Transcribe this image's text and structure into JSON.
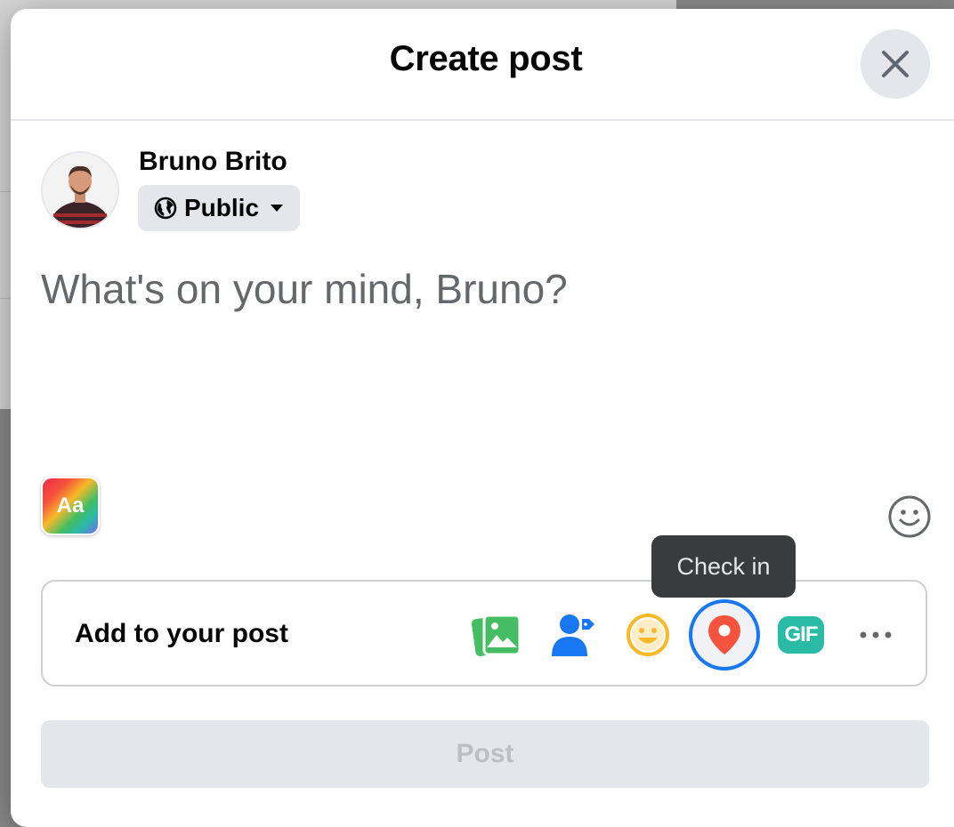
{
  "dialog": {
    "title": "Create post"
  },
  "author": {
    "name": "Bruno Brito",
    "audience_label": "Public"
  },
  "composer": {
    "placeholder": "What's on your mind, Bruno?"
  },
  "background_picker": {
    "label": "Aa"
  },
  "add_to_post": {
    "label": "Add to your post",
    "tools": [
      {
        "name": "photo-video",
        "icon": "photo-icon",
        "color": "#45bd62"
      },
      {
        "name": "tag-people",
        "icon": "tag-people-icon",
        "color": "#1877f2"
      },
      {
        "name": "feeling-activity",
        "icon": "smiley-icon",
        "color": "#f7b928"
      },
      {
        "name": "check-in",
        "icon": "location-pin-icon",
        "color": "#f5533d",
        "active": true
      },
      {
        "name": "gif",
        "icon": "gif-icon",
        "label": "GIF",
        "color": "#2abba7"
      },
      {
        "name": "more",
        "icon": "more-icon",
        "color": "#65676b"
      }
    ]
  },
  "tooltip": {
    "text": "Check in"
  },
  "post_button": {
    "label": "Post",
    "enabled": false
  },
  "colors": {
    "accent": "#1877f2",
    "button_disabled_bg": "#e4e6eb",
    "placeholder_text": "#65676b"
  }
}
